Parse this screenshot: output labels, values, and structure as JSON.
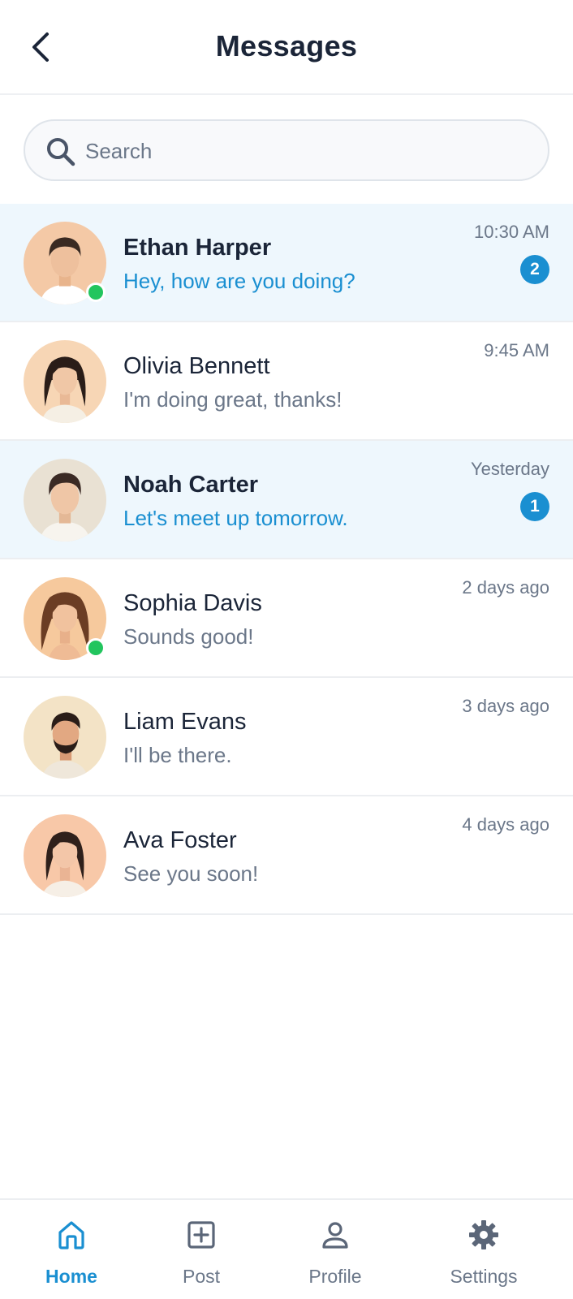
{
  "header": {
    "title": "Messages",
    "back_icon": "chevron-left-icon"
  },
  "search": {
    "placeholder": "Search",
    "value": "",
    "icon": "search-icon"
  },
  "conversations": [
    {
      "name": "Ethan Harper",
      "preview": "Hey, how are you doing?",
      "time": "10:30 AM",
      "unread": "2",
      "online": true
    },
    {
      "name": "Olivia Bennett",
      "preview": "I'm doing great, thanks!",
      "time": "9:45 AM",
      "unread": "",
      "online": false
    },
    {
      "name": "Noah Carter",
      "preview": "Let's meet up tomorrow.",
      "time": "Yesterday",
      "unread": "1",
      "online": false
    },
    {
      "name": "Sophia Davis",
      "preview": "Sounds good!",
      "time": "2 days ago",
      "unread": "",
      "online": true
    },
    {
      "name": "Liam Evans",
      "preview": "I'll be there.",
      "time": "3 days ago",
      "unread": "",
      "online": false
    },
    {
      "name": "Ava Foster",
      "preview": "See you soon!",
      "time": "4 days ago",
      "unread": "",
      "online": false
    }
  ],
  "tabbar": {
    "items": [
      {
        "label": "Home",
        "icon": "home-icon",
        "active": true
      },
      {
        "label": "Post",
        "icon": "plus-square-icon",
        "active": false
      },
      {
        "label": "Profile",
        "icon": "user-icon",
        "active": false
      },
      {
        "label": "Settings",
        "icon": "gear-icon",
        "active": false
      }
    ]
  },
  "colors": {
    "accent": "#1a8fd1",
    "online": "#22c55e",
    "unread_row": "#eef7fd",
    "muted": "#6b7789",
    "text": "#1b2538"
  }
}
